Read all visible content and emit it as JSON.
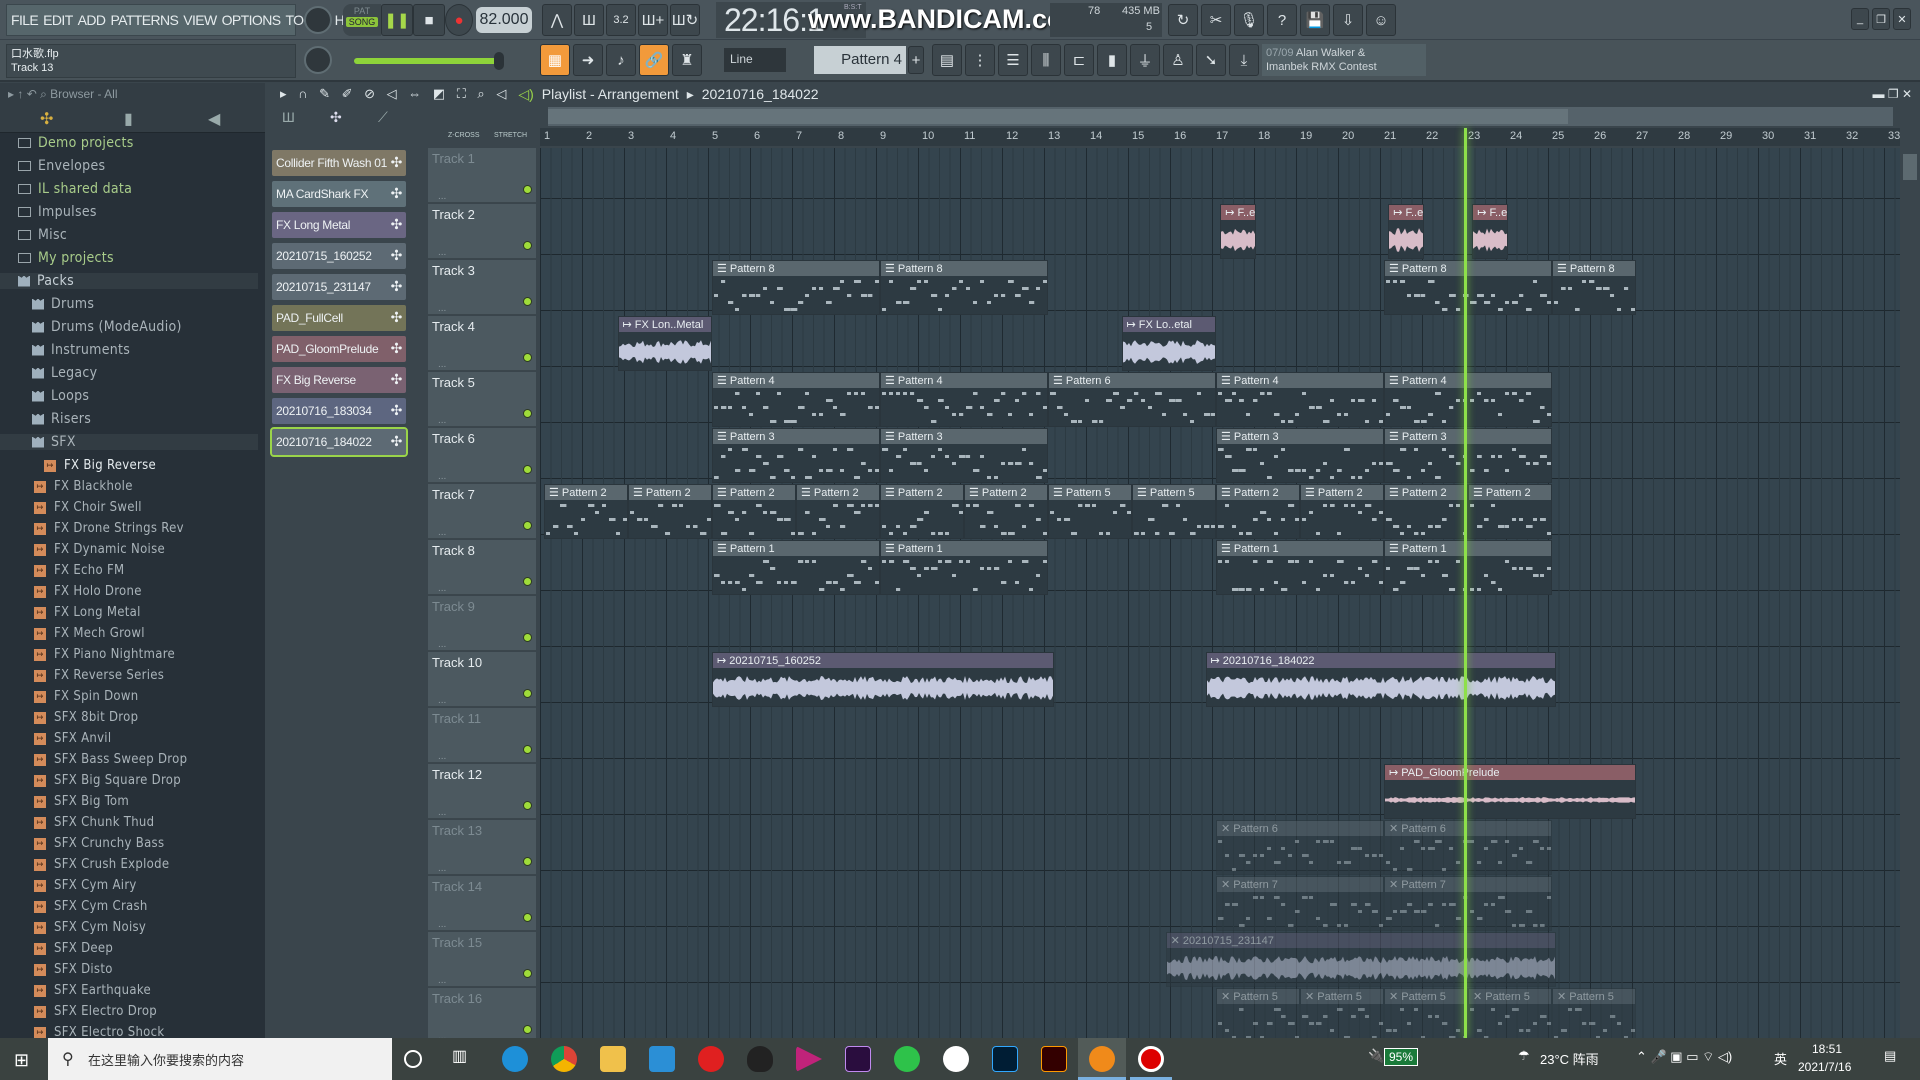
{
  "menu": [
    "FILE",
    "EDIT",
    "ADD",
    "PATTERNS",
    "VIEW",
    "OPTIONS",
    "TOOLS",
    "HELP"
  ],
  "transport": {
    "pat": "PAT",
    "song": "SONG",
    "tempo": "82.000",
    "time": "22:16:1",
    "time_label": "B:S:T",
    "cpu": "78",
    "memory": "435 MB",
    "polyphony": "5"
  },
  "watermark": "www.BANDICAM.com",
  "hint": {
    "file": "口水歌.flp",
    "item": "Track 13"
  },
  "toolbar2": {
    "snap": "Line",
    "pattern": "Pattern 4",
    "news_date": "07/09",
    "news_line1": "Alan Walker &",
    "news_line2": "Imanbek RMX Contest"
  },
  "playlist": {
    "title": "Playlist - Arrangement",
    "breadcrumb": "20210716_184022",
    "zcross": "Z-CROSS",
    "stretch": "STRETCH"
  },
  "browser": {
    "title": "Browser - All",
    "folders": [
      {
        "label": "Demo projects",
        "hl": true
      },
      {
        "label": "Envelopes"
      },
      {
        "label": "IL shared data",
        "hl": true
      },
      {
        "label": "Impulses"
      },
      {
        "label": "Misc"
      },
      {
        "label": "My projects",
        "hl": true
      }
    ],
    "packs": "Packs",
    "pack_items": [
      "Drums",
      "Drums (ModeAudio)",
      "Instruments",
      "Legacy",
      "Loops",
      "Risers",
      "SFX"
    ],
    "sfx_items": [
      "FX Big Reverse",
      "FX Blackhole",
      "FX Choir Swell",
      "FX Drone Strings Rev",
      "FX Dynamic Noise",
      "FX Echo FM",
      "FX Holo Drone",
      "FX Long Metal",
      "FX Mech Growl",
      "FX Piano Nightmare",
      "FX Reverse Series",
      "FX Spin Down",
      "SFX 8bit Drop",
      "SFX Anvil",
      "SFX Bass Sweep Drop",
      "SFX Big Square Drop",
      "SFX Big Tom",
      "SFX Chunk Thud",
      "SFX Crunchy Bass",
      "SFX Crush Explode",
      "SFX Cym Airy",
      "SFX Cym Crash",
      "SFX Cym Noisy",
      "SFX Deep",
      "SFX Disto",
      "SFX Earthquake",
      "SFX Electro Drop",
      "SFX Electro Shock"
    ]
  },
  "picker": [
    {
      "label": "Collider Fifth Wash 01",
      "color": "#7f7866"
    },
    {
      "label": "MA CardShark FX",
      "color": "#5f7179"
    },
    {
      "label": "FX Long Metal",
      "color": "#6a6683"
    },
    {
      "label": "20210715_160252",
      "color": "#5d6a74"
    },
    {
      "label": "20210715_231147",
      "color": "#5d6a74"
    },
    {
      "label": "PAD_FullCell",
      "color": "#737458"
    },
    {
      "label": "PAD_GloomPrelude",
      "color": "#80606a"
    },
    {
      "label": "FX Big Reverse",
      "color": "#7a6272"
    },
    {
      "label": "20210716_183034",
      "color": "#5d6680"
    },
    {
      "label": "20210716_184022",
      "color": "#5d6a74",
      "selected": true
    }
  ],
  "ruler": [
    1,
    2,
    3,
    4,
    5,
    6,
    7,
    8,
    9,
    10,
    11,
    12,
    13,
    14,
    15,
    16,
    17,
    18,
    19,
    20,
    21,
    22,
    23,
    24,
    25,
    26,
    27,
    28,
    29,
    30,
    31,
    32,
    33
  ],
  "playhead_bar": 22.9,
  "tracks": [
    {
      "label": "Track 1",
      "muted": true
    },
    {
      "label": "Track 2"
    },
    {
      "label": "Track 3"
    },
    {
      "label": "Track 4"
    },
    {
      "label": "Track 5"
    },
    {
      "label": "Track 6"
    },
    {
      "label": "Track 7"
    },
    {
      "label": "Track 8"
    },
    {
      "label": "Track 9",
      "muted": true
    },
    {
      "label": "Track 10"
    },
    {
      "label": "Track 11",
      "muted": true
    },
    {
      "label": "Track 12"
    },
    {
      "label": "Track 13",
      "muted": true
    },
    {
      "label": "Track 14",
      "muted": true
    },
    {
      "label": "Track 15",
      "muted": true
    },
    {
      "label": "Track 16",
      "muted": true
    }
  ],
  "clips": [
    {
      "track": 2,
      "start": 17.1,
      "length": 0.85,
      "name": "F..e",
      "kind": "audio",
      "style": "pink"
    },
    {
      "track": 2,
      "start": 21.1,
      "length": 0.85,
      "name": "F..e",
      "kind": "audio",
      "style": "pink"
    },
    {
      "track": 2,
      "start": 23.1,
      "length": 0.85,
      "name": "F..e",
      "kind": "audio",
      "style": "pink"
    },
    {
      "track": 3,
      "start": 5,
      "length": 4,
      "name": "Pattern 8",
      "kind": "pattern"
    },
    {
      "track": 3,
      "start": 9,
      "length": 4,
      "name": "Pattern 8",
      "kind": "pattern"
    },
    {
      "track": 3,
      "start": 21,
      "length": 4,
      "name": "Pattern 8",
      "kind": "pattern"
    },
    {
      "track": 3,
      "start": 25,
      "length": 2,
      "name": "Pattern 8",
      "kind": "pattern"
    },
    {
      "track": 4,
      "start": 2.75,
      "length": 2.25,
      "name": "FX Lon..Metal",
      "kind": "audio"
    },
    {
      "track": 4,
      "start": 14.75,
      "length": 2.25,
      "name": "FX Lo..etal",
      "kind": "audio"
    },
    {
      "track": 5,
      "start": 5,
      "length": 4,
      "name": "Pattern 4",
      "kind": "pattern"
    },
    {
      "track": 5,
      "start": 9,
      "length": 4,
      "name": "Pattern 4",
      "kind": "pattern"
    },
    {
      "track": 5,
      "start": 13,
      "length": 4,
      "name": "Pattern 6",
      "kind": "pattern"
    },
    {
      "track": 5,
      "start": 17,
      "length": 4,
      "name": "Pattern 4",
      "kind": "pattern"
    },
    {
      "track": 5,
      "start": 21,
      "length": 4,
      "name": "Pattern 4",
      "kind": "pattern"
    },
    {
      "track": 6,
      "start": 5,
      "length": 4,
      "name": "Pattern 3",
      "kind": "pattern"
    },
    {
      "track": 6,
      "start": 9,
      "length": 4,
      "name": "Pattern 3",
      "kind": "pattern"
    },
    {
      "track": 6,
      "start": 17,
      "length": 4,
      "name": "Pattern 3",
      "kind": "pattern"
    },
    {
      "track": 6,
      "start": 21,
      "length": 4,
      "name": "Pattern 3",
      "kind": "pattern"
    },
    {
      "track": 7,
      "start": 1,
      "length": 2,
      "name": "Pattern 2",
      "kind": "pattern"
    },
    {
      "track": 7,
      "start": 3,
      "length": 2,
      "name": "Pattern 2",
      "kind": "pattern"
    },
    {
      "track": 7,
      "start": 5,
      "length": 2,
      "name": "Pattern 2",
      "kind": "pattern"
    },
    {
      "track": 7,
      "start": 7,
      "length": 2,
      "name": "Pattern 2",
      "kind": "pattern"
    },
    {
      "track": 7,
      "start": 9,
      "length": 2,
      "name": "Pattern 2",
      "kind": "pattern"
    },
    {
      "track": 7,
      "start": 11,
      "length": 2,
      "name": "Pattern 2",
      "kind": "pattern"
    },
    {
      "track": 7,
      "start": 13,
      "length": 2,
      "name": "Pattern 5",
      "kind": "pattern"
    },
    {
      "track": 7,
      "start": 15,
      "length": 2,
      "name": "Pattern 5",
      "kind": "pattern"
    },
    {
      "track": 7,
      "start": 17,
      "length": 2,
      "name": "Pattern 2",
      "kind": "pattern"
    },
    {
      "track": 7,
      "start": 19,
      "length": 2,
      "name": "Pattern 2",
      "kind": "pattern"
    },
    {
      "track": 7,
      "start": 21,
      "length": 2,
      "name": "Pattern 2",
      "kind": "pattern"
    },
    {
      "track": 7,
      "start": 23,
      "length": 2,
      "name": "Pattern 2",
      "kind": "pattern"
    },
    {
      "track": 8,
      "start": 5,
      "length": 4,
      "name": "Pattern 1",
      "kind": "pattern"
    },
    {
      "track": 8,
      "start": 9,
      "length": 4,
      "name": "Pattern 1",
      "kind": "pattern"
    },
    {
      "track": 8,
      "start": 17,
      "length": 4,
      "name": "Pattern 1",
      "kind": "pattern"
    },
    {
      "track": 8,
      "start": 21,
      "length": 4,
      "name": "Pattern 1",
      "kind": "pattern"
    },
    {
      "track": 10,
      "start": 5,
      "length": 8.15,
      "name": "20210715_160252",
      "kind": "audio"
    },
    {
      "track": 10,
      "start": 16.75,
      "length": 8.35,
      "name": "20210716_184022",
      "kind": "audio"
    },
    {
      "track": 12,
      "start": 21,
      "length": 6,
      "name": "PAD_GloomPrelude",
      "kind": "audio",
      "style": "pink"
    },
    {
      "track": 13,
      "start": 17,
      "length": 4,
      "name": "Pattern 6",
      "kind": "pattern",
      "muted": true
    },
    {
      "track": 13,
      "start": 21,
      "length": 4,
      "name": "Pattern 6",
      "kind": "pattern",
      "muted": true
    },
    {
      "track": 14,
      "start": 17,
      "length": 4,
      "name": "Pattern 7",
      "kind": "pattern",
      "muted": true
    },
    {
      "track": 14,
      "start": 21,
      "length": 4,
      "name": "Pattern 7",
      "kind": "pattern",
      "muted": true
    },
    {
      "track": 15,
      "start": 15.8,
      "length": 9.3,
      "name": "20210715_231147",
      "kind": "audio",
      "muted": true
    },
    {
      "track": 16,
      "start": 17,
      "length": 2,
      "name": "Pattern 5",
      "kind": "pattern",
      "muted": true
    },
    {
      "track": 16,
      "start": 19,
      "length": 2,
      "name": "Pattern 5",
      "kind": "pattern",
      "muted": true
    },
    {
      "track": 16,
      "start": 21,
      "length": 2,
      "name": "Pattern 5",
      "kind": "pattern",
      "muted": true
    },
    {
      "track": 16,
      "start": 23,
      "length": 2,
      "name": "Pattern 5",
      "kind": "pattern",
      "muted": true
    },
    {
      "track": 16,
      "start": 25,
      "length": 2,
      "name": "Pattern 5",
      "kind": "pattern",
      "muted": true
    }
  ],
  "taskbar": {
    "search_placeholder": "在这里输入你要搜索的内容",
    "battery": "95%",
    "weather": "23°C 阵雨",
    "ime": "英",
    "clock": "18:51",
    "date": "2021/7/16"
  },
  "colors": {
    "accent": "#f29a3b",
    "playhead": "#8ee04a",
    "led": "#9fdc3a"
  }
}
